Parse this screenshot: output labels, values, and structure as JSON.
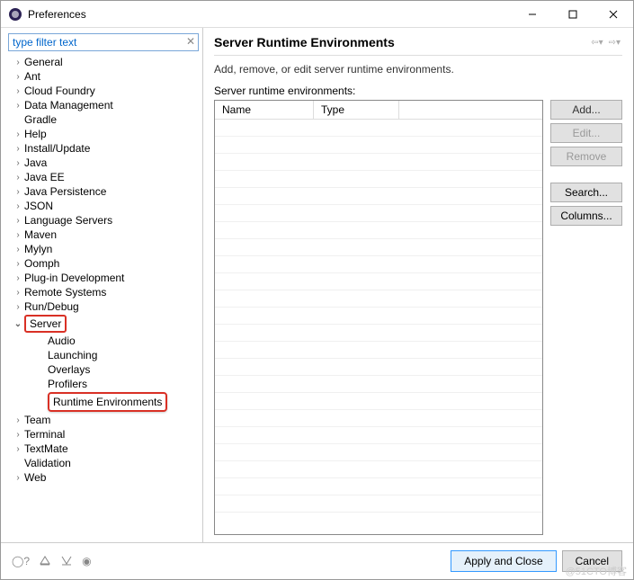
{
  "window": {
    "title": "Preferences"
  },
  "filter": {
    "value": "type filter text"
  },
  "tree": {
    "items": [
      {
        "label": "General",
        "level": 0,
        "arrow": ">"
      },
      {
        "label": "Ant",
        "level": 0,
        "arrow": ">"
      },
      {
        "label": "Cloud Foundry",
        "level": 0,
        "arrow": ">"
      },
      {
        "label": "Data Management",
        "level": 0,
        "arrow": ">"
      },
      {
        "label": "Gradle",
        "level": 0,
        "arrow": ""
      },
      {
        "label": "Help",
        "level": 0,
        "arrow": ">"
      },
      {
        "label": "Install/Update",
        "level": 0,
        "arrow": ">"
      },
      {
        "label": "Java",
        "level": 0,
        "arrow": ">"
      },
      {
        "label": "Java EE",
        "level": 0,
        "arrow": ">"
      },
      {
        "label": "Java Persistence",
        "level": 0,
        "arrow": ">"
      },
      {
        "label": "JSON",
        "level": 0,
        "arrow": ">"
      },
      {
        "label": "Language Servers",
        "level": 0,
        "arrow": ">"
      },
      {
        "label": "Maven",
        "level": 0,
        "arrow": ">"
      },
      {
        "label": "Mylyn",
        "level": 0,
        "arrow": ">"
      },
      {
        "label": "Oomph",
        "level": 0,
        "arrow": ">"
      },
      {
        "label": "Plug-in Development",
        "level": 0,
        "arrow": ">"
      },
      {
        "label": "Remote Systems",
        "level": 0,
        "arrow": ">"
      },
      {
        "label": "Run/Debug",
        "level": 0,
        "arrow": ">"
      },
      {
        "label": "Server",
        "level": 0,
        "arrow": "v",
        "highlighted": true
      },
      {
        "label": "Audio",
        "level": 1,
        "arrow": ""
      },
      {
        "label": "Launching",
        "level": 1,
        "arrow": ""
      },
      {
        "label": "Overlays",
        "level": 1,
        "arrow": ""
      },
      {
        "label": "Profilers",
        "level": 1,
        "arrow": ""
      },
      {
        "label": "Runtime Environments",
        "level": 1,
        "arrow": "",
        "selected": true
      },
      {
        "label": "Team",
        "level": 0,
        "arrow": ">"
      },
      {
        "label": "Terminal",
        "level": 0,
        "arrow": ">"
      },
      {
        "label": "TextMate",
        "level": 0,
        "arrow": ">"
      },
      {
        "label": "Validation",
        "level": 0,
        "arrow": ""
      },
      {
        "label": "Web",
        "level": 0,
        "arrow": ">"
      }
    ]
  },
  "main": {
    "heading": "Server Runtime Environments",
    "description": "Add, remove, or edit server runtime environments.",
    "listLabel": "Server runtime environments:",
    "columns": {
      "name": "Name",
      "type": "Type"
    }
  },
  "buttons": {
    "add": "Add...",
    "edit": "Edit...",
    "remove": "Remove",
    "search": "Search...",
    "columns": "Columns..."
  },
  "footer": {
    "apply": "Apply and Close",
    "cancel": "Cancel"
  },
  "watermark": "@51CTO博客"
}
